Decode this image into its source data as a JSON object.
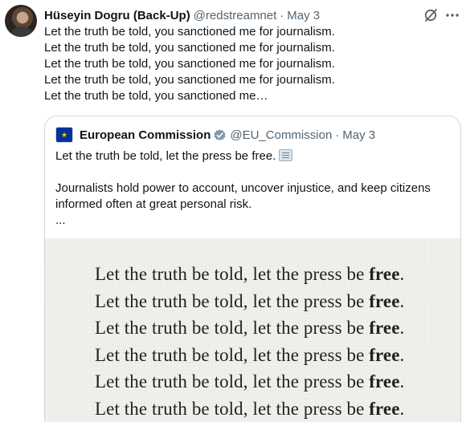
{
  "tweet": {
    "author_name": "Hüseyin Dogru (Back-Up)",
    "author_handle": "@redstreamnet",
    "separator": "·",
    "time": "May 3",
    "lines": [
      "Let the truth be told, you sanctioned me for journalism.",
      "Let the truth be told, you sanctioned me for journalism.",
      "Let the truth be told, you sanctioned me for journalism.",
      "Let the truth be told, you sanctioned me for journalism.",
      "Let the truth be told, you sanctioned me…"
    ],
    "icons": [
      "grok-icon",
      "more-icon",
      "avatar"
    ]
  },
  "quote": {
    "author_name": "European Commission",
    "author_handle": "@EU_Commission",
    "separator": "·",
    "time": "May 3",
    "text_first": "Let the truth be told, let the press be free.",
    "text_second": "Journalists hold power to account, uncover injustice, and keep citizens informed often at great personal risk.",
    "ellipsis": "...",
    "icons": [
      "eu-flag-icon",
      "gov-verified-badge-icon",
      "newspaper-emoji-icon"
    ],
    "media": {
      "line_prefix": "Let the truth be told, let the press be ",
      "line_bold": "free",
      "line_suffix": ".",
      "lines_visible": 6
    }
  },
  "colors": {
    "text_primary": "#0f1419",
    "text_secondary": "#536471",
    "border": "#cfd9de",
    "media_background": "#f2f0ed"
  }
}
